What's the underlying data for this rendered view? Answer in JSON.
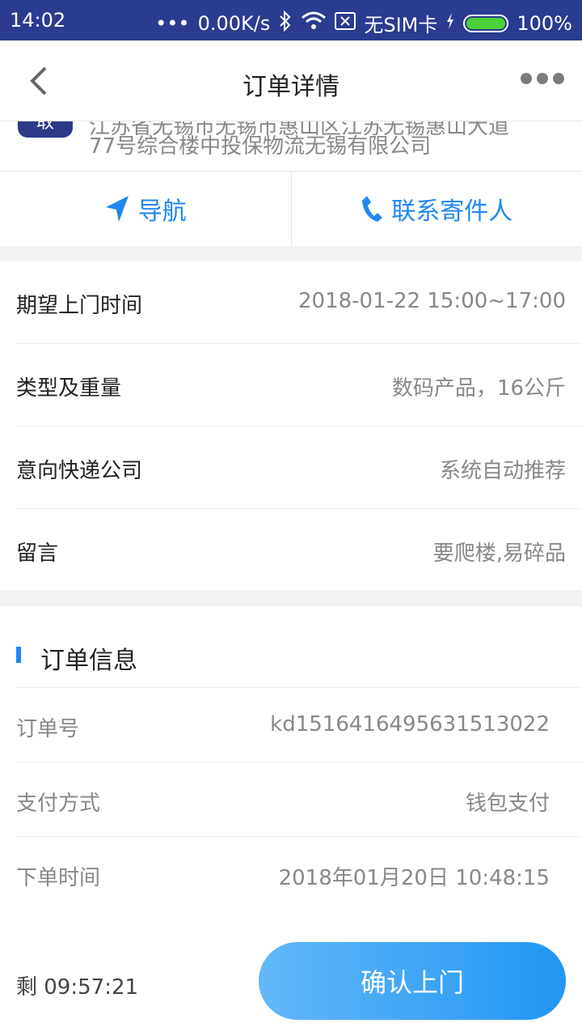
{
  "status_bar": {
    "time": "14:02",
    "dots": "•••",
    "net_speed": "0.00K/s",
    "sim": "无SIM卡",
    "battery": "100%",
    "battery_level": 1.0,
    "icons": [
      "bluetooth-icon",
      "wifi-icon",
      "sim-x-icon",
      "charging-icon",
      "battery-icon"
    ]
  },
  "header": {
    "title": "订单详情",
    "back_icon": "chevron-left-icon",
    "more_icon": "more-dots-icon"
  },
  "address": {
    "badge": "取",
    "line_cut": "江苏省无锡市无锡市惠山区江苏无锡惠山大道",
    "line": "77号综合楼中投保物流无锡有限公司"
  },
  "actions": {
    "navigate_label": "导航",
    "contact_label": "联系寄件人"
  },
  "details": [
    {
      "label": "期望上门时间",
      "value": "2018-01-22 15:00~17:00"
    },
    {
      "label": "类型及重量",
      "value": "数码产品，16公斤"
    },
    {
      "label": "意向快递公司",
      "value": "系统自动推荐"
    },
    {
      "label": "留言",
      "value": "要爬楼,易碎品"
    }
  ],
  "order_info": {
    "title": "订单信息",
    "rows": [
      {
        "label": "订单号",
        "value": "kd1516416495631513022"
      },
      {
        "label": "支付方式",
        "value": "钱包支付"
      },
      {
        "label": "下单时间",
        "value": "2018年01月20日 10:48:15"
      }
    ]
  },
  "footer": {
    "countdown": "剩 09:57:21",
    "confirm_label": "确认上门"
  },
  "colors": {
    "status_bar_bg": "#2b3b8f",
    "accent": "#1f87f0",
    "button_gradient_start": "#63b8f8",
    "button_gradient_end": "#2196f3"
  }
}
